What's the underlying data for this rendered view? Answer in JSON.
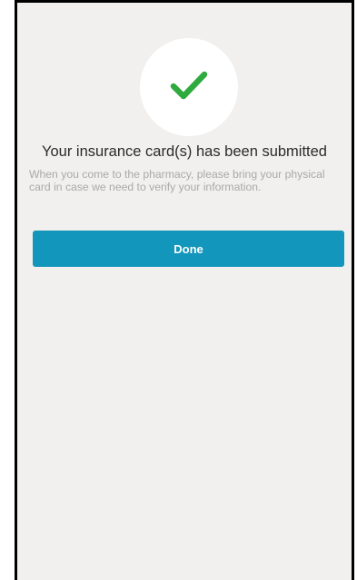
{
  "confirmation": {
    "icon": "checkmark-icon",
    "icon_color": "#2faa3f",
    "title": "Your insurance card(s) has been submitted",
    "message": "When you come to the pharmacy, please bring your physical card in case we need to verify your information."
  },
  "actions": {
    "done_label": "Done",
    "done_color": "#1396bb"
  },
  "colors": {
    "background": "#f2f0ee"
  }
}
